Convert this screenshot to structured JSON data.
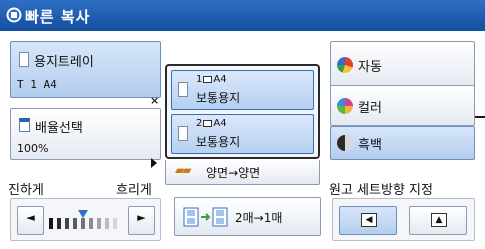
{
  "title": {
    "text": "빠른 복사",
    "icon": "copy-app-icon"
  },
  "paper": {
    "label": "용지트레이",
    "value": "T 1  A4"
  },
  "paper_dropdown": {
    "options": [
      {
        "number": "1",
        "size": "A4",
        "name": "보통용지"
      },
      {
        "number": "2",
        "size": "A4",
        "name": "보통용지"
      }
    ]
  },
  "reduce": {
    "label": "배율선택",
    "value": "100%"
  },
  "duplex": {
    "label": "양면→양면"
  },
  "color_modes": {
    "auto": "자동",
    "color": "컬러",
    "mono": "흑백",
    "selected": "mono"
  },
  "density": {
    "dark_label": "진하게",
    "light_label": "흐리게",
    "left_arrow": "◄",
    "right_arrow": "►",
    "level_fraction": 0.5
  },
  "nup": {
    "label": "2매→1매"
  },
  "orientation": {
    "title": "원고 세트방향 지정"
  },
  "colors": {
    "titlebar": "#2f6fc6",
    "selected_button": "#b3cdee",
    "border_dark": "#2a2a2a"
  }
}
